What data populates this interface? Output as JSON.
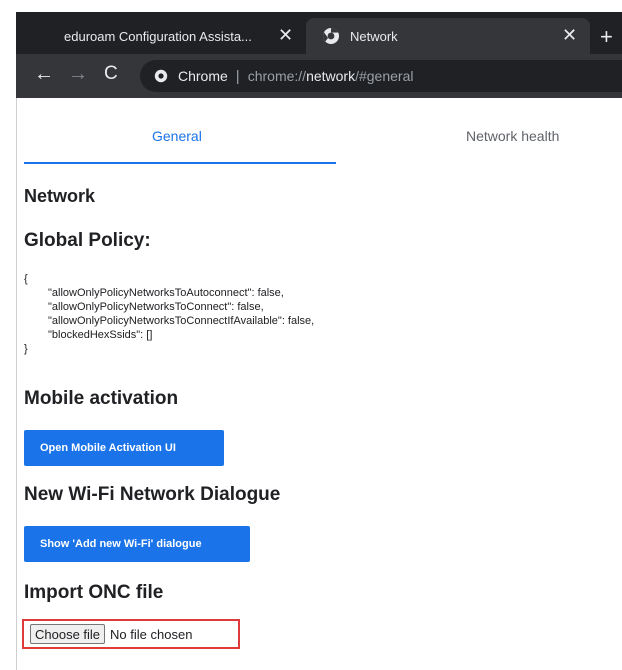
{
  "browser": {
    "tabs": [
      {
        "label": "eduroam Configuration Assista...",
        "active": false
      },
      {
        "label": "Network",
        "active": true
      }
    ],
    "close_glyph": "✕",
    "new_tab_glyph": "+",
    "nav": {
      "back": "←",
      "forward": "→",
      "reload": "C"
    },
    "omnibox": {
      "site_label": "Chrome",
      "separator": "|",
      "url_scheme": "chrome://",
      "url_host": "network",
      "url_path": "/#general"
    },
    "colors": {
      "frame": "#202124",
      "toolbar": "#35363a",
      "accent": "#1a73e8"
    }
  },
  "page": {
    "tabs": [
      {
        "label": "General",
        "selected": true
      },
      {
        "label": "Network health",
        "selected": false
      }
    ],
    "network_heading": "Network",
    "policy_heading": "Global Policy:",
    "policy_json": {
      "open": "{",
      "lines": [
        "\"allowOnlyPolicyNetworksToAutoconnect\": false,",
        "\"allowOnlyPolicyNetworksToConnect\": false,",
        "\"allowOnlyPolicyNetworksToConnectIfAvailable\": false,",
        "\"blockedHexSsids\": []"
      ],
      "close": "}"
    },
    "mobile_heading": "Mobile activation",
    "mobile_button": "Open Mobile Activation UI",
    "wifi_heading": "New Wi-Fi Network Dialogue",
    "wifi_button": "Show 'Add new Wi-Fi' dialogue",
    "onc_heading": "Import ONC file",
    "file_button": "Choose file",
    "file_status": "No file chosen"
  }
}
